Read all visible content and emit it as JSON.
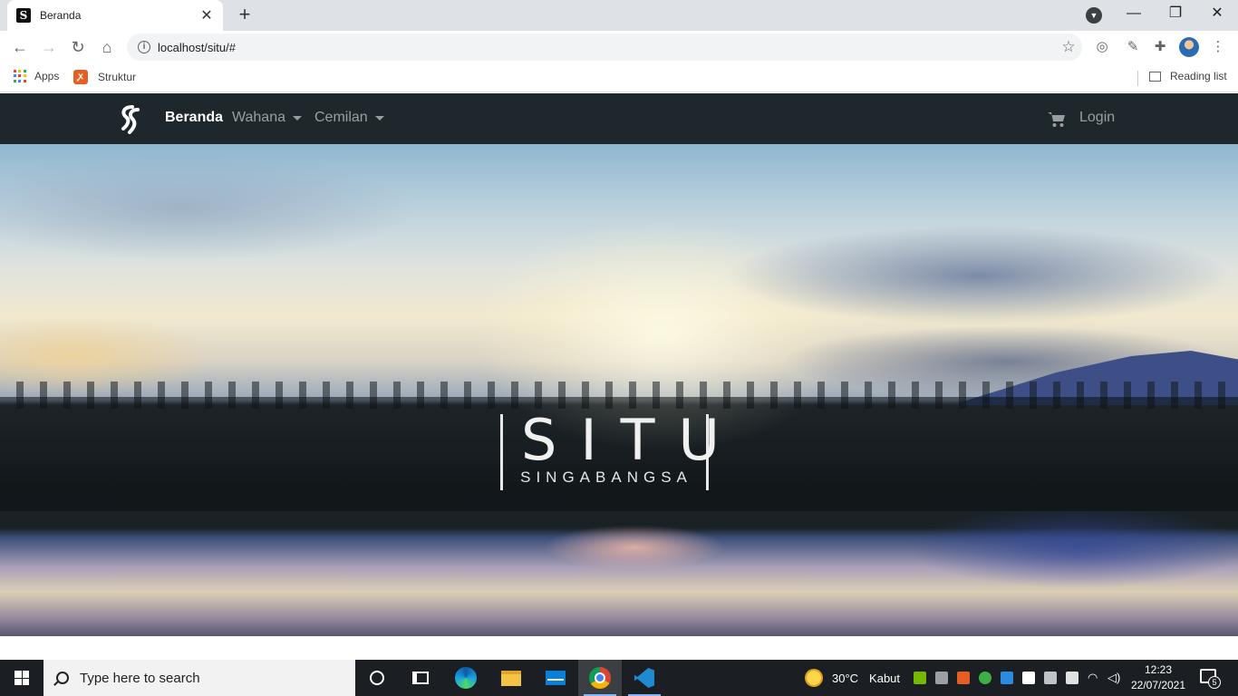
{
  "browser": {
    "tab_title": "Beranda",
    "tab_favicon": "S",
    "url": "localhost/situ/#",
    "bookmarks": [
      {
        "label": "Apps",
        "icon": "apps-grid-icon"
      },
      {
        "label": "Struktur",
        "icon": "xampp-icon"
      }
    ],
    "reading_list": "Reading list"
  },
  "site": {
    "nav": {
      "links": [
        {
          "label": "Beranda",
          "active": true
        },
        {
          "label": "Wahana",
          "dropdown": true
        },
        {
          "label": "Cemilan",
          "dropdown": true
        }
      ],
      "cart_icon": "cart-icon",
      "login_label": "Login"
    },
    "hero": {
      "title": "SITU",
      "subtitle": "SINGABANGSA"
    }
  },
  "taskbar": {
    "search_placeholder": "Type here to search",
    "weather_temp": "30°C",
    "weather_text": "Kabut",
    "time": "12:23",
    "date": "22/07/2021",
    "notification_count": "5"
  },
  "colors": {
    "navbar_bg": "#1e272b",
    "taskbar_bg": "#1b1f23",
    "tabstrip_bg": "#dee1e6"
  }
}
